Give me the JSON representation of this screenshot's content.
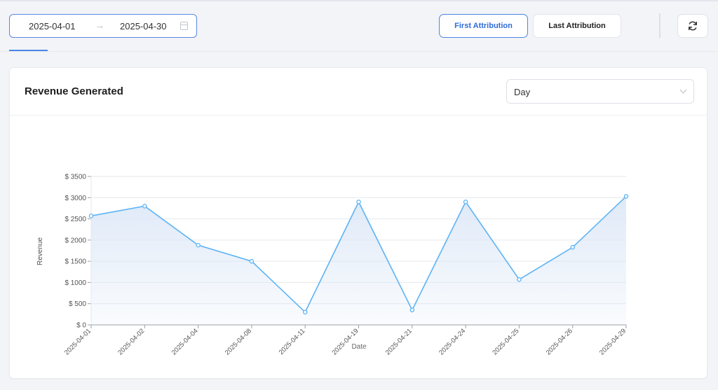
{
  "filters": {
    "date_start": "2025-04-01",
    "date_arrow": "→",
    "date_end": "2025-04-30",
    "calendar_icon": "calendar-icon"
  },
  "attribution": {
    "first_label": "First Attribution",
    "last_label": "Last Attribution",
    "selected": "First Attribution"
  },
  "refresh": {
    "icon": "refresh-icon"
  },
  "card": {
    "title": "Revenue Generated",
    "granularity": {
      "selected": "Day"
    }
  },
  "colors": {
    "accent": "#4a86e8",
    "line": "#5cb3f5",
    "area_top": "#dde8f7"
  },
  "chart_data": {
    "type": "line",
    "area": true,
    "xlabel": "Date",
    "ylabel": "Revenue",
    "y_tick_prefix": "$ ",
    "ylim": [
      0,
      3500
    ],
    "y_ticks": [
      0,
      500,
      1000,
      1500,
      2000,
      2500,
      3000,
      3500
    ],
    "grid": true,
    "categories": [
      "2025-04-01",
      "2025-04-02",
      "2025-04-04",
      "2025-04-08",
      "2025-04-11",
      "2025-04-19",
      "2025-04-21",
      "2025-04-24",
      "2025-04-25",
      "2025-04-26",
      "2025-04-29"
    ],
    "series": [
      {
        "values": [
          2570,
          2800,
          1880,
          1500,
          300,
          2900,
          350,
          2900,
          1070,
          1830,
          3030
        ]
      }
    ]
  }
}
